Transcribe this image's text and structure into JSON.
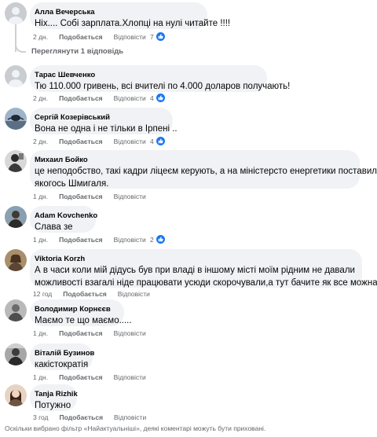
{
  "comments": [
    {
      "author": "Алла Вечерська",
      "text": "Ніх.... Собі зарплата.Хлопці на нулі читайте !!!!",
      "time": "2 дн.",
      "like": "Подобається",
      "reply": "Відповісти",
      "reactions": "7"
    },
    {
      "author": "Тарас Шевченко",
      "text": "Тю 110.000 гривень, всі вчителі по 4.000 доларов получають!",
      "time": "2 дн.",
      "like": "Подобається",
      "reply": "Відповісти",
      "reactions": "4"
    },
    {
      "author": "Сергій Козерівський",
      "text": "Вона не одна і не тільки в Ірпені ..",
      "time": "2 дн.",
      "like": "Подобається",
      "reply": "Відповісти",
      "reactions": "4"
    },
    {
      "author": "Михаил Бойко",
      "text_lines": [
        "це неподобство, такі кадри лiцеєм керують, а на міністерсто енергетики поставили",
        "якогось Шмигаля."
      ],
      "time": "1 дн.",
      "like": "Подобається",
      "reply": "Відповісти",
      "reactions": ""
    },
    {
      "author": "Adam Kovchenko",
      "text": "Слава зе",
      "time": "1 дн.",
      "like": "Подобається",
      "reply": "Відповісти",
      "reactions": "2"
    },
    {
      "author": "Viktoria Korzh",
      "text_lines": [
        "А в часи коли мій дідусь був при владі в іншому місті моїм рідним не давали",
        "можливості взагалі ніде працювати усюди скорочували,а тут бачите як все можна..."
      ],
      "time": "12 год",
      "like": "Подобається",
      "reply": "Відповісти",
      "reactions": ""
    },
    {
      "author": "Володимир Корнєєв",
      "text": "Маємо те що маємо.....",
      "time": "1 дн.",
      "like": "Подобається",
      "reply": "Відповісти",
      "reactions": ""
    },
    {
      "author": "Віталій Бузинов",
      "text": "какістократія",
      "time": "1 дн.",
      "like": "Подобається",
      "reply": "Відповісти",
      "reactions": ""
    },
    {
      "author": "Tanja Rizhik",
      "text": "Потужно",
      "time": "3 год",
      "like": "Подобається",
      "reply": "Відповісти",
      "reactions": ""
    }
  ],
  "view_replies": "Переглянути 1 відповідь",
  "footer_note": "Оскільки вибрано фільтр «Найактуальніші», деякі коментарі можуть бути приховані.",
  "colors": {
    "bubble": "#f0f2f5",
    "meta": "#65676b",
    "like_blue": "#1877f2"
  }
}
